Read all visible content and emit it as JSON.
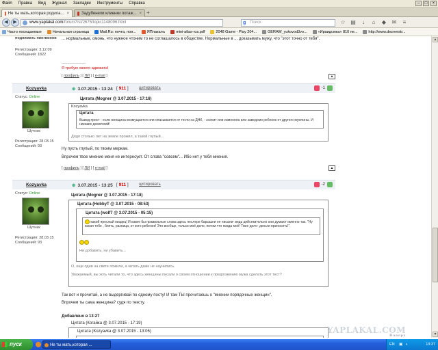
{
  "menu": [
    "Файл",
    "Правка",
    "Вид",
    "Журнал",
    "Закладки",
    "Инструменты",
    "Справка"
  ],
  "tabs": [
    {
      "label": "Не ты мать,которая родила..."
    },
    {
      "label": "Задубенели клиенки потаж..."
    }
  ],
  "nav": {
    "url_host": "www.yaplakal.com",
    "url_path": "/forum7/st/2675/topic1148096.html",
    "search_placeholder": "Поиск"
  },
  "bookmarks": [
    "Часто посещаемые",
    "Начальная страница",
    "Mail.Ru: почта, пои...",
    "ЯПлакалъ",
    "mini-atlas-rus.pdf",
    "2048 Game - Play 204...",
    "GERAW_yukovod3vo...",
    "«Ираидсюка» 810 пе...",
    "http://www.dezreestr..."
  ],
  "page": {
    "prev_post": {
      "signature_line": "поднимать пингвинов",
      "reg_label": "Регистрация: 3.12.09",
      "msgs_label": "Сообщений: 1822",
      "text": "... нормальные, омонь, что нужное чтоним то не соглашалось в обществе. Нормальные в ... доказывать мужу, что \"этот точно от тебя\".",
      "sig_dashes": "---------------------",
      "sig_red": "Я требую своего адвоката!",
      "links": [
        "профиль",
        "ЛИ",
        "e-mail"
      ]
    },
    "post1": {
      "nick": "Kozyavka",
      "date": "3.07.2015 - 13:24",
      "rating": "911",
      "cite": "цитировать",
      "minus": "-1",
      "status_label": "Статус:",
      "status": "Online",
      "role": "Шутник",
      "reg": "Регистрация: 28.03.15",
      "msgs": "Сообщений: 93",
      "outer_quote_head": "Цитата (Mogner @ 3.07.2015 - 17:16)",
      "outer_quote_author": "Kozyavka",
      "inner_quote_head": "Цитата",
      "inner_quote_text": "Вывод прост - если женщина возмущается или опасывается от тести на ДНК, - значит или изменяла или заведомо ребенок от другого мужчины. И никаких демогогий!",
      "outer_quote_text": "Дядя столько лет на земле прожил, а такой глупый...",
      "body1": "Ну пусть глупый, по твоим меркам.",
      "body2": "Впрочем твое мнение меня не интересует. От слова \"совсем\"... Ибо нет у тебя мнения.",
      "links": [
        "профиль",
        "ЛИ",
        "e-mail"
      ]
    },
    "post2": {
      "nick": "Kozyavka",
      "date": "3.07.2015 - 13:25",
      "rating": "911",
      "cite": "цитировать",
      "minus": "-2",
      "status_label": "Статус:",
      "status": "Online",
      "role": "Шутник",
      "reg": "Регистрация: 28.03.15",
      "msgs": "Сообщений: 93",
      "q1_head": "Цитата (Mogner @ 3.07.2015 - 17:18)",
      "q2_head": "Цитата (HobbyT @ 3.07.2015 - 08:53)",
      "q3_head": "Цитата (wolf7 @ 3.07.2015 - 05:15)",
      "q3_text": "какой ярослый пиздец! И какие бы правильные слова здесь неслере барышни не писали- ведь действительно они думают именно так. \"Ну какая тебе , блять, разница, от кого ребенок! Это вообще, только моё дело, потом что пизда моё! Твое дело- деньги приносить!\".",
      "q2_text": "Ни добавить, ни убавить...",
      "q1_text": "О, еще одни на свете пожили, а читать даже не научились.",
      "q1_text2": "Уважаемый, вы хоть читали то, что здесь женщины писали о своем отношении к предложению мужа сделать этот тест?",
      "body1": "Так вот и прочитай, а не выдергивай по одному посту! И там ТЫ прочитаешь о \"мнении порядочных женщин\".",
      "body2": "Впрочем ты сама женщина? судя по тексту.",
      "added": "Добавлено в 13:27",
      "q4_head": "Цитата (Когайка @ 3.07.2015 - 17:19)",
      "q5_head": "Цитата (Kozyavka @ 3.07.2015 - 13:05)",
      "links": [
        "профиль",
        "ЛИ",
        "e-mail"
      ]
    }
  },
  "watermark": "YAPLAKAL.COM",
  "watermark_sub": "Наверх",
  "taskbar": {
    "start": "пуск",
    "item": "Не ты мать,которая ...",
    "lang": "EN",
    "clock": "13:37"
  }
}
